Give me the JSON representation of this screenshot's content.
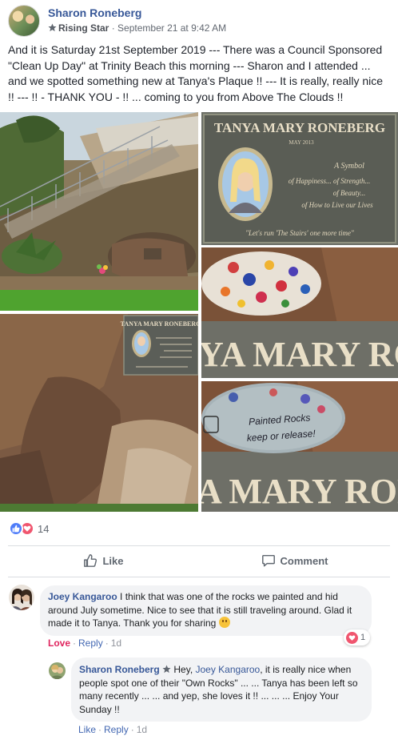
{
  "post": {
    "author": "Sharon Roneberg",
    "badge_label": "Rising Star",
    "separator": "·",
    "timestamp": "September 21 at 9:42 AM",
    "text": "And it is Saturday 21st September 2019 --- There was a Council Sponsored \"Clean Up Day\" at Trinity Beach this morning --- Sharon and I attended ... and we spotted something new at Tanya's Plaque !! --- It is really, really nice !! --- !! - THANK YOU - !! ... coming to you from Above The Clouds !!"
  },
  "photos": {
    "plaque": {
      "name": "TANYA MARY RONEBERG",
      "date": "MAY 2013",
      "verse": [
        "A Symbol",
        "of Happiness... of Strength...",
        "of Beauty...",
        "of How to Live our Lives"
      ],
      "footer": "\"Let's run 'The Stairs' one more time\""
    },
    "small_plaque_name": "TANYA MARY RONEBERG",
    "closeup_text_1": "YA MARY RONE",
    "closeup_text_2": "A MARY RONE",
    "rock_message": [
      "Painted Rocks",
      "keep or release!"
    ]
  },
  "reactions": {
    "count": "14"
  },
  "actions": {
    "like_label": "Like",
    "comment_label": "Comment"
  },
  "comments": [
    {
      "author": "Joey Kangaroo",
      "text": " I think that was one of the rocks we painted and hid around July sometime. Nice to see that it is still traveling around. Glad it made it to Tanya. Thank you for sharing ",
      "reaction_label": "Love",
      "reply_label": "Reply",
      "time": "1d",
      "reaction_count": "1"
    },
    {
      "author": "Sharon Roneberg",
      "text_before": " Hey, ",
      "mention": "Joey Kangaroo",
      "text_after": ", it is really nice when people spot one of their \"Own Rocks\" ... ... Tanya has been left so many recently ... ... and yep, she loves it !! ... ... ... Enjoy Your Sunday !!",
      "like_label": "Like",
      "reply_label": "Reply",
      "time": "1d"
    }
  ],
  "colors": {
    "link_blue": "#385898",
    "like_blue": "#4f7df9",
    "love_red": "#f0566f",
    "bubble_gray": "#f2f3f5"
  }
}
